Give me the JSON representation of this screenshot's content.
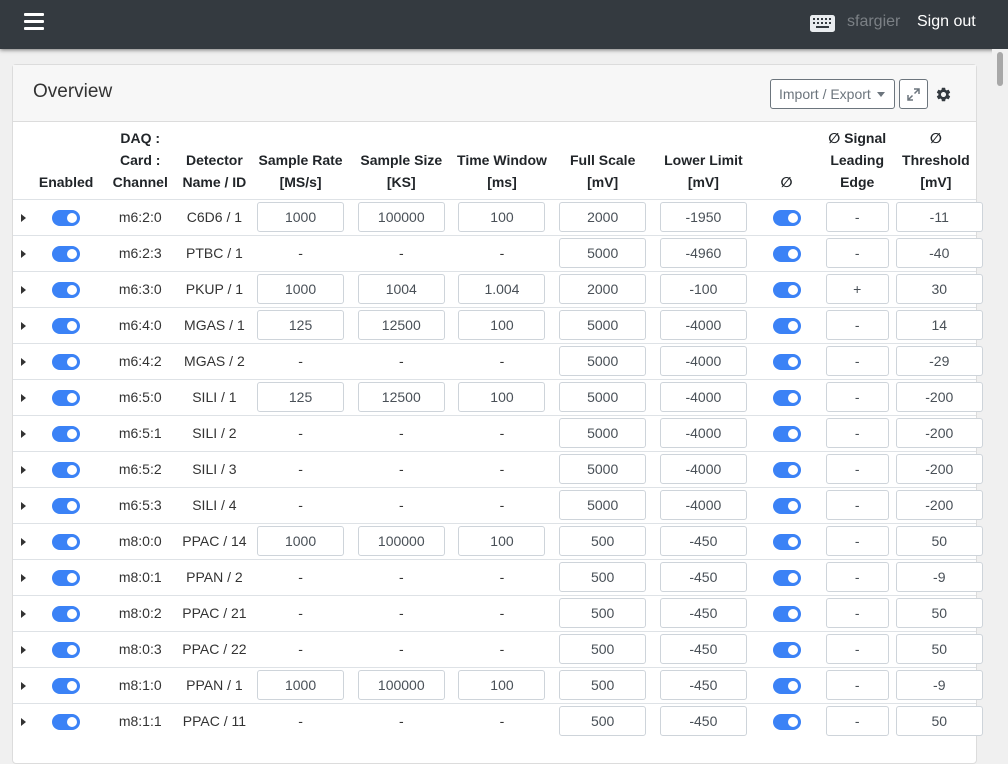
{
  "navbar": {
    "user": "sfargier",
    "sign_out": "Sign out",
    "keyboard_icon": "keyboard-icon",
    "menu_icon": "hamburger-icon"
  },
  "card": {
    "title": "Overview",
    "import_export_label": "Import / Export",
    "expand_icon": "expand-icon",
    "settings_icon": "gear-icon"
  },
  "table": {
    "headers": [
      "",
      "Enabled",
      "DAQ : Card : Channel",
      "Detector Name / ID",
      "Sample Rate [MS/s]",
      "Sample Size [KS]",
      "Time Window [ms]",
      "Full Scale [mV]",
      "Lower Limit [mV]",
      "∅",
      "∅ Signal Leading Edge",
      "∅ Threshold [mV]"
    ],
    "rows": [
      {
        "enabled": true,
        "channel": "m6:2:0",
        "detector": "C6D6 / 1",
        "sample_rate": "1000",
        "sample_size": "100000",
        "time_window": "100",
        "full_scale": "2000",
        "lower_limit": "-1950",
        "inverted": true,
        "leading_edge": "-",
        "threshold": "-11"
      },
      {
        "enabled": true,
        "channel": "m6:2:3",
        "detector": "PTBC / 1",
        "sample_rate": "-",
        "sample_size": "-",
        "time_window": "-",
        "full_scale": "5000",
        "lower_limit": "-4960",
        "inverted": true,
        "leading_edge": "-",
        "threshold": "-40"
      },
      {
        "enabled": true,
        "channel": "m6:3:0",
        "detector": "PKUP / 1",
        "sample_rate": "1000",
        "sample_size": "1004",
        "time_window": "1.004",
        "full_scale": "2000",
        "lower_limit": "-100",
        "inverted": true,
        "leading_edge": "+",
        "threshold": "30"
      },
      {
        "enabled": true,
        "channel": "m6:4:0",
        "detector": "MGAS / 1",
        "sample_rate": "125",
        "sample_size": "12500",
        "time_window": "100",
        "full_scale": "5000",
        "lower_limit": "-4000",
        "inverted": true,
        "leading_edge": "-",
        "threshold": "14"
      },
      {
        "enabled": true,
        "channel": "m6:4:2",
        "detector": "MGAS / 2",
        "sample_rate": "-",
        "sample_size": "-",
        "time_window": "-",
        "full_scale": "5000",
        "lower_limit": "-4000",
        "inverted": true,
        "leading_edge": "-",
        "threshold": "-29"
      },
      {
        "enabled": true,
        "channel": "m6:5:0",
        "detector": "SILI / 1",
        "sample_rate": "125",
        "sample_size": "12500",
        "time_window": "100",
        "full_scale": "5000",
        "lower_limit": "-4000",
        "inverted": true,
        "leading_edge": "-",
        "threshold": "-200"
      },
      {
        "enabled": true,
        "channel": "m6:5:1",
        "detector": "SILI / 2",
        "sample_rate": "-",
        "sample_size": "-",
        "time_window": "-",
        "full_scale": "5000",
        "lower_limit": "-4000",
        "inverted": true,
        "leading_edge": "-",
        "threshold": "-200"
      },
      {
        "enabled": true,
        "channel": "m6:5:2",
        "detector": "SILI / 3",
        "sample_rate": "-",
        "sample_size": "-",
        "time_window": "-",
        "full_scale": "5000",
        "lower_limit": "-4000",
        "inverted": true,
        "leading_edge": "-",
        "threshold": "-200"
      },
      {
        "enabled": true,
        "channel": "m6:5:3",
        "detector": "SILI / 4",
        "sample_rate": "-",
        "sample_size": "-",
        "time_window": "-",
        "full_scale": "5000",
        "lower_limit": "-4000",
        "inverted": true,
        "leading_edge": "-",
        "threshold": "-200"
      },
      {
        "enabled": true,
        "channel": "m8:0:0",
        "detector": "PPAC / 14",
        "sample_rate": "1000",
        "sample_size": "100000",
        "time_window": "100",
        "full_scale": "500",
        "lower_limit": "-450",
        "inverted": true,
        "leading_edge": "-",
        "threshold": "50"
      },
      {
        "enabled": true,
        "channel": "m8:0:1",
        "detector": "PPAN / 2",
        "sample_rate": "-",
        "sample_size": "-",
        "time_window": "-",
        "full_scale": "500",
        "lower_limit": "-450",
        "inverted": true,
        "leading_edge": "-",
        "threshold": "-9"
      },
      {
        "enabled": true,
        "channel": "m8:0:2",
        "detector": "PPAC / 21",
        "sample_rate": "-",
        "sample_size": "-",
        "time_window": "-",
        "full_scale": "500",
        "lower_limit": "-450",
        "inverted": true,
        "leading_edge": "-",
        "threshold": "50"
      },
      {
        "enabled": true,
        "channel": "m8:0:3",
        "detector": "PPAC / 22",
        "sample_rate": "-",
        "sample_size": "-",
        "time_window": "-",
        "full_scale": "500",
        "lower_limit": "-450",
        "inverted": true,
        "leading_edge": "-",
        "threshold": "50"
      },
      {
        "enabled": true,
        "channel": "m8:1:0",
        "detector": "PPAN / 1",
        "sample_rate": "1000",
        "sample_size": "100000",
        "time_window": "100",
        "full_scale": "500",
        "lower_limit": "-450",
        "inverted": true,
        "leading_edge": "-",
        "threshold": "-9"
      },
      {
        "enabled": true,
        "channel": "m8:1:1",
        "detector": "PPAC / 11",
        "sample_rate": "-",
        "sample_size": "-",
        "time_window": "-",
        "full_scale": "500",
        "lower_limit": "-450",
        "inverted": true,
        "leading_edge": "-",
        "threshold": "50"
      }
    ]
  },
  "colors": {
    "navbar": "#343a40",
    "toggle_on": "#3b82f6",
    "border": "#dee2e6"
  }
}
